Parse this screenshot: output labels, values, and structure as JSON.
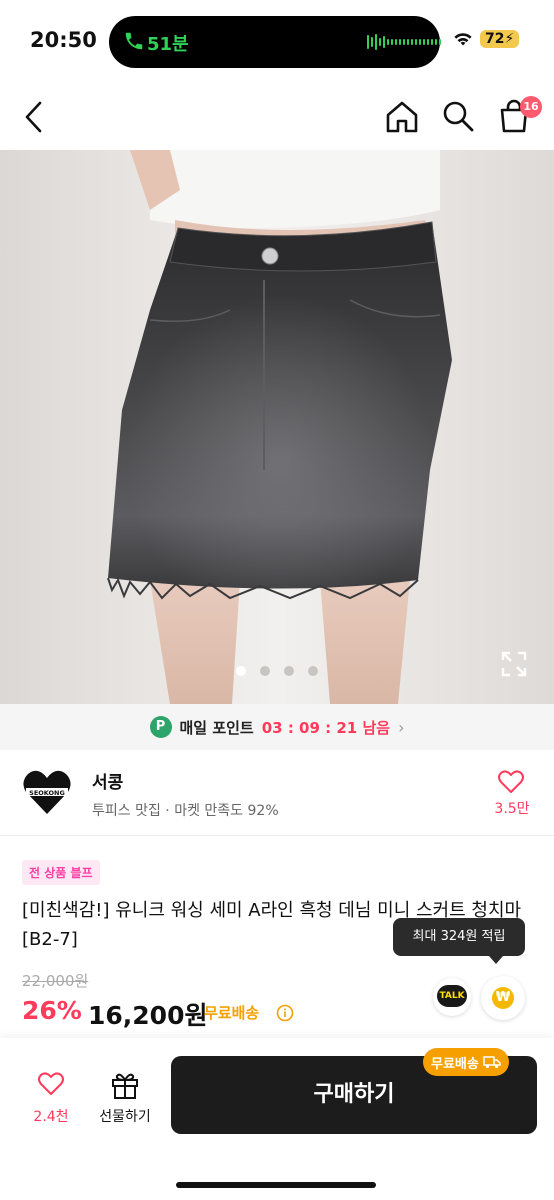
{
  "status_bar": {
    "time": "20:50",
    "call_duration": "51분",
    "battery": "72"
  },
  "nav": {
    "cart_count": "16"
  },
  "gallery": {
    "page_count": 4,
    "current_page": 1
  },
  "points_banner": {
    "badge": "P",
    "label": "매일 포인트",
    "timer": "03 : 09 : 21 남음",
    "chevron": "›"
  },
  "shop": {
    "logo_text": "SEOKONG",
    "name": "서콩",
    "description": "투피스 맛집 · 마켓 만족도 92%",
    "likes": "3.5만"
  },
  "product": {
    "tag": "전 상품 블프",
    "title": "[미친색감!] 유니크 워싱 세미 A라인 흑청 데님 미니 스커트 청치마 [B2-7]",
    "original_price": "22,000원",
    "discount": "26%",
    "price": "16,200원",
    "shipping": "무료배송",
    "points_tooltip": "최대 324원 적립",
    "talk_label": "TALK",
    "coin_symbol": "₩"
  },
  "bottom_bar": {
    "like_count": "2.4천",
    "gift_label": "선물하기",
    "buy_label": "구매하기",
    "free_shipping_badge": "무료배송"
  },
  "colors": {
    "accent_pink": "#ff3b5c",
    "shipping_orange": "#f5a000",
    "points_green": "#2da56a",
    "buy_button": "#1c1c1c"
  }
}
